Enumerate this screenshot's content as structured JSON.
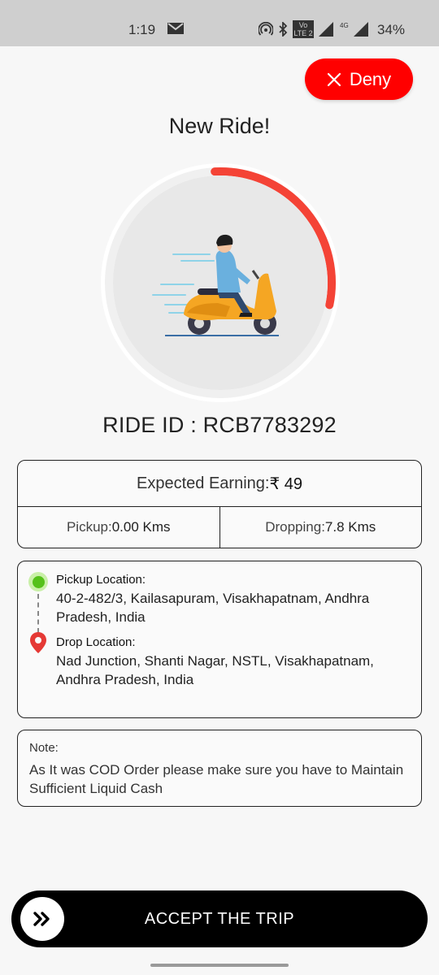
{
  "status_bar": {
    "time": "1:19",
    "volte_label": "Vo LTE 2",
    "network_label": "4G",
    "battery": "34%"
  },
  "header": {
    "deny_label": "Deny",
    "title": "New Ride!"
  },
  "timer": {
    "remaining_fraction": 0.29,
    "accent_color": "#f44336"
  },
  "ride": {
    "id_text": "RIDE ID : RCB7783292"
  },
  "earnings": {
    "label": "Expected Earning:",
    "value": "₹ 49",
    "pickup_label": "Pickup:",
    "pickup_value": "0.00 Kms",
    "dropping_label": "Dropping:",
    "dropping_value": "7.8 Kms"
  },
  "locations": {
    "pickup_label": "Pickup Location:",
    "pickup_address": "40-2-482/3, Kailasapuram, Visakhapatnam, Andhra Pradesh, India",
    "drop_label": "Drop Location:",
    "drop_address": "Nad Junction, Shanti Nagar, NSTL, Visakhapatnam, Andhra Pradesh, India"
  },
  "note": {
    "label": "Note:",
    "text": "As It was COD Order please make sure you have to Maintain Sufficient Liquid Cash"
  },
  "accept": {
    "label": "ACCEPT THE TRIP"
  },
  "icons": {
    "deny": "close-icon",
    "accept": "double-chevron-right-icon",
    "pickup": "pickup-dot-icon",
    "drop": "location-pin-icon"
  },
  "colors": {
    "deny_bg": "#ff0000",
    "pickup_green": "#55c11a",
    "drop_red": "#e53935",
    "accept_bg": "#000000"
  }
}
